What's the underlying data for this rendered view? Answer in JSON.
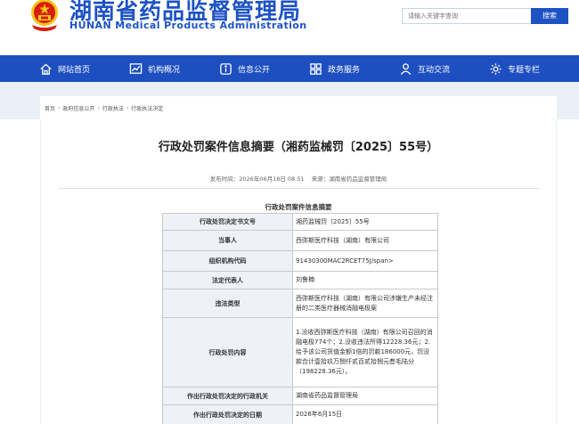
{
  "header": {
    "title": "湖南省药品监督管理局",
    "subtitle": "HUNAN Medical Products Administration",
    "search_placeholder": "请输入关键字查询",
    "search_button": "搜索"
  },
  "nav": {
    "items": [
      {
        "label": "网站首页",
        "icon": "home-icon"
      },
      {
        "label": "机构概况",
        "icon": "chart-icon"
      },
      {
        "label": "信息公开",
        "icon": "info-icon"
      },
      {
        "label": "政务服务",
        "icon": "grid-icon"
      },
      {
        "label": "互动交流",
        "icon": "people-icon"
      },
      {
        "label": "专题专栏",
        "icon": "gear-icon"
      }
    ]
  },
  "breadcrumb": [
    "首页",
    "政府信息公开",
    "行政执法",
    "行政执法决定"
  ],
  "article": {
    "title": "行政处罚案件信息摘要（湘药监械罚〔2025〕55号）",
    "publish_time": "发布时间：2026年06月18日 08:51",
    "source": "来源：湖南省药品监督管理局"
  },
  "summary_table": {
    "caption": "行政处罚案件信息摘要",
    "rows": [
      {
        "key": "行政处罚决定书文号",
        "value": "湘药监械罚〔2025〕55号"
      },
      {
        "key": "当事人",
        "value": "西弥斯医疗科技（湖南）有限公司"
      },
      {
        "key": "组织机构代码",
        "value": "91430300MAC2RCET75J/span>"
      },
      {
        "key": "法定代表人",
        "value": "刘鲁楠"
      },
      {
        "key": "违法类型",
        "value": "西弥斯医疗科技（湖南）有限公司涉嫌生产未经注册的二类医疗器械消融电极案"
      },
      {
        "key": "行政处罚内容",
        "value": "1.没收西弥斯医疗科技（湖南）有限公司召回的消融电极774个；2.没收违法所得12228.36元；2.给予该公司货值金额1倍的罚款186000元，罚没款合计壹拾玖万捌仟贰百贰拾捌元叁毛陆分（198228.36元）。"
      },
      {
        "key": "作出行政处罚决定的行政机关",
        "value": "湖南省药品监督管理局"
      },
      {
        "key": "作出行政处罚决定的日期",
        "value": "2026年6月15日"
      }
    ]
  },
  "colors": {
    "brand_blue": "#1d52c4",
    "nav_blue": "#1d4fc0",
    "emblem_red": "#d81e06",
    "emblem_gold": "#f5c518",
    "crumb_bg": "#eaf0f8",
    "table_key_bg": "#eef1f6"
  }
}
